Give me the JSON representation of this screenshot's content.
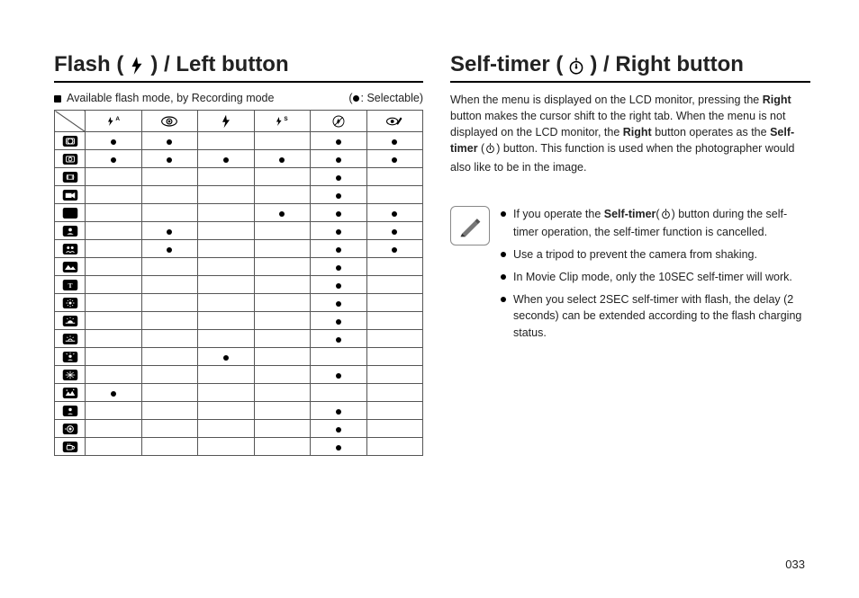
{
  "page_number": "033",
  "left": {
    "heading_prefix": "Flash (",
    "heading_suffix": ") / Left button",
    "caption": "Available flash mode, by Recording mode",
    "legend": ": Selectable)",
    "legend_prefix": "(",
    "columns": [
      "flash-auto",
      "redeye",
      "fill-flash",
      "slow-sync",
      "flash-off",
      "redeye-fix"
    ],
    "rows": [
      {
        "mode": "auto",
        "cells": [
          true,
          true,
          false,
          false,
          true,
          true
        ]
      },
      {
        "mode": "program",
        "cells": [
          true,
          true,
          true,
          true,
          true,
          true
        ]
      },
      {
        "mode": "dual-is",
        "cells": [
          false,
          false,
          false,
          false,
          true,
          false
        ]
      },
      {
        "mode": "movie",
        "cells": [
          false,
          false,
          false,
          false,
          true,
          false
        ]
      },
      {
        "mode": "night",
        "cells": [
          false,
          false,
          false,
          true,
          true,
          true
        ]
      },
      {
        "mode": "portrait",
        "cells": [
          false,
          true,
          false,
          false,
          true,
          true
        ]
      },
      {
        "mode": "children",
        "cells": [
          false,
          true,
          false,
          false,
          true,
          true
        ]
      },
      {
        "mode": "landscape",
        "cells": [
          false,
          false,
          false,
          false,
          true,
          false
        ]
      },
      {
        "mode": "text",
        "cells": [
          false,
          false,
          false,
          false,
          true,
          false
        ]
      },
      {
        "mode": "closeup",
        "cells": [
          false,
          false,
          false,
          false,
          true,
          false
        ]
      },
      {
        "mode": "sunset",
        "cells": [
          false,
          false,
          false,
          false,
          true,
          false
        ]
      },
      {
        "mode": "dawn",
        "cells": [
          false,
          false,
          false,
          false,
          true,
          false
        ]
      },
      {
        "mode": "backlight",
        "cells": [
          false,
          false,
          true,
          false,
          false,
          false
        ]
      },
      {
        "mode": "fireworks",
        "cells": [
          false,
          false,
          false,
          false,
          true,
          false
        ]
      },
      {
        "mode": "beach-snow",
        "cells": [
          true,
          false,
          false,
          false,
          false,
          false
        ]
      },
      {
        "mode": "self-shot",
        "cells": [
          false,
          false,
          false,
          false,
          true,
          false
        ]
      },
      {
        "mode": "food",
        "cells": [
          false,
          false,
          false,
          false,
          true,
          false
        ]
      },
      {
        "mode": "cafe",
        "cells": [
          false,
          false,
          false,
          false,
          true,
          false
        ]
      }
    ]
  },
  "right": {
    "heading_prefix": "Self-timer (",
    "heading_suffix": ") / Right button",
    "para_parts": {
      "p1": "When the menu is displayed on the LCD monitor, pressing the ",
      "b1": "Right",
      "p2": " button makes the cursor shift to the right tab. When the menu is not displayed on the LCD monitor, the ",
      "b2": "Right",
      "p3": " button operates as the ",
      "b3": "Self-timer",
      "p4": " (",
      "p5": ") button. This function is used when the photographer would also like to be in the image."
    },
    "notes": {
      "n1a": "If you operate the ",
      "n1b": "Self-timer",
      "n1c": "(",
      "n1d": ") button during the self-timer operation, the self-timer function is cancelled.",
      "n2": "Use a tripod to prevent the camera from shaking.",
      "n3": "In Movie Clip mode, only the 10SEC self-timer will work.",
      "n4": "When you select 2SEC self-timer with flash, the delay (2 seconds) can be extended according to the flash charging status."
    }
  }
}
